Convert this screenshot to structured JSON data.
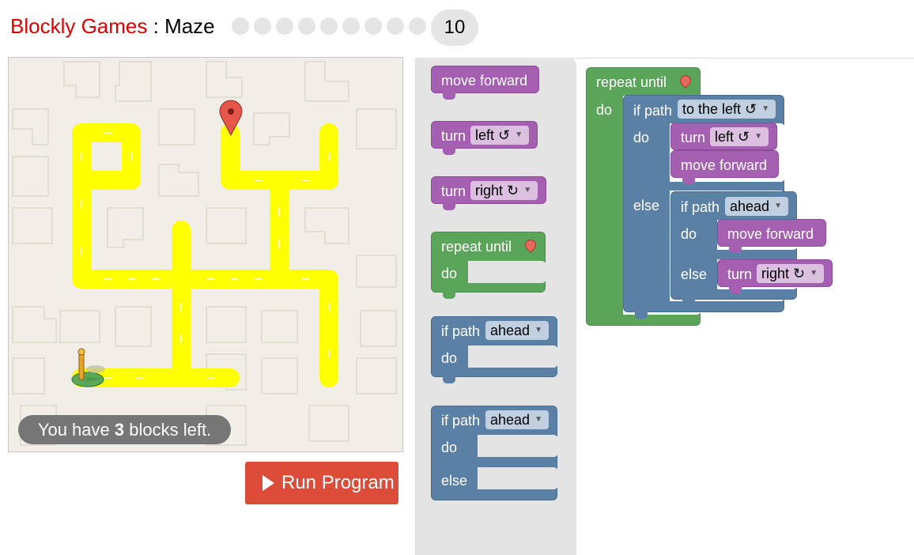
{
  "header": {
    "app_name": "Blockly Games",
    "separator": " : ",
    "game_name": "Maze",
    "current_level": "10",
    "level_count": 10
  },
  "maze": {
    "capacity_prefix": "You have ",
    "capacity_count": "3",
    "capacity_suffix": " blocks left."
  },
  "run_button": {
    "label": "Run Program"
  },
  "toolbox": {
    "move_forward": "move forward",
    "turn_left": {
      "label": "turn",
      "dir": "left ↺"
    },
    "turn_right": {
      "label": "turn",
      "dir": "right ↻"
    },
    "repeat": {
      "label": "repeat until",
      "do": "do"
    },
    "if": {
      "label": "if path",
      "dir": "ahead",
      "do": "do"
    },
    "ifelse": {
      "label": "if path",
      "dir": "ahead",
      "do": "do",
      "else": "else"
    }
  },
  "workspace": {
    "repeat_label": "repeat until",
    "repeat_do": "do",
    "if1_label": "if path",
    "if1_dir": "to the left ↺",
    "if1_do": "do",
    "turn1_label": "turn",
    "turn1_dir": "left ↺",
    "move1": "move forward",
    "if1_else": "else",
    "if2_label": "if path",
    "if2_dir": "ahead",
    "if2_do": "do",
    "move2": "move forward",
    "if2_else": "else",
    "turn2_label": "turn",
    "turn2_dir": "right ↻"
  },
  "colors": {
    "title_red": "#dd0000",
    "run_button": "#dd4b39",
    "movement_block": "#a55fb1",
    "loop_block": "#5ba55b",
    "logic_block": "#5b80a5",
    "path": "#ffff00",
    "maze_bg": "#f1eee7"
  }
}
